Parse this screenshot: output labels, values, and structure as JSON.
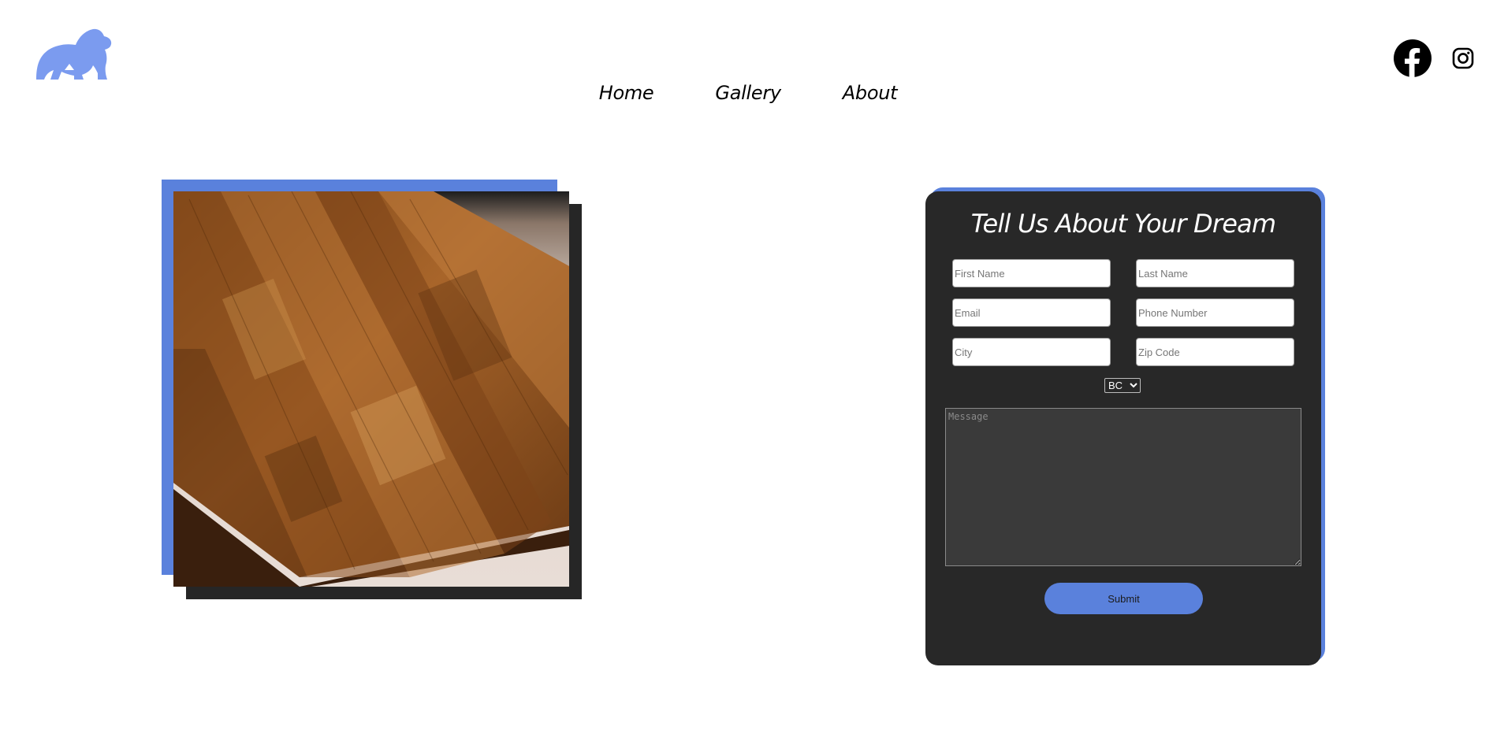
{
  "brand": {
    "logo_icon": "gorilla-icon",
    "logo_color": "#7b9bef"
  },
  "social": {
    "facebook_icon": "facebook-icon",
    "instagram_icon": "instagram-icon"
  },
  "nav": {
    "items": [
      {
        "label": "Home"
      },
      {
        "label": "Gallery"
      },
      {
        "label": "About"
      }
    ]
  },
  "hero": {
    "image": "wooden-cutting-board-photo",
    "accent_color": "#5a81dc",
    "shadow_color": "#262626"
  },
  "form": {
    "title": "Tell Us About Your Dream",
    "first_name_placeholder": "First Name",
    "last_name_placeholder": "Last Name",
    "email_placeholder": "Email",
    "phone_placeholder": "Phone Number",
    "city_placeholder": "City",
    "zip_placeholder": "Zip Code",
    "province_selected": "BC",
    "message_placeholder": "Message",
    "submit_label": "Submit",
    "card_color": "#282828",
    "accent_color": "#5a81dc"
  }
}
